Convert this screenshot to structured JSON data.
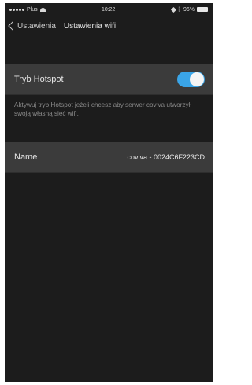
{
  "statusbar": {
    "carrier": "Plus",
    "time": "10:22",
    "battery": "96%"
  },
  "navbar": {
    "back_label": "Ustawienia",
    "title": "Ustawienia wifi"
  },
  "hotspot": {
    "label": "Tryb Hotspot",
    "enabled": true,
    "footnote": "Aktywuj tryb Hotspot jeżeli chcesz aby serwer coviva utworzył swoją własną sieć wifi."
  },
  "name_row": {
    "label": "Name",
    "value": "coviva - 0024C6F223CD"
  },
  "colors": {
    "background": "#1c1c1c",
    "row_background": "#3b3b3b",
    "toggle_on": "#3aa5e8"
  }
}
